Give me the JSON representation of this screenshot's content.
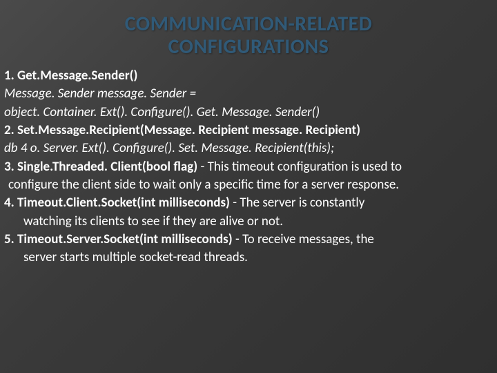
{
  "title_line1": "COMMUNICATION-RELATED",
  "title_line2": "CONFIGURATIONS",
  "items": {
    "i1": {
      "num": "1. ",
      "head": "Get.Message.Sender()",
      "code_a": "Message. Sender message. Sender =",
      "code_b": " object. Container. Ext(). Configure(). Get. Message. Sender()"
    },
    "i2": {
      "num": "2. ",
      "head": "Set.Message.Recipient(Message. Recipient message. Recipient)",
      "code": "db 4 o. Server. Ext(). Configure(). Set. Message. Recipient(this);"
    },
    "i3": {
      "num": "3. ",
      "head": "Single.Threaded. Client(bool flag)",
      "sep": " - ",
      "desc_a": "This timeout configuration is used to",
      "desc_b": " configure the client side to wait only a specific time for a server response."
    },
    "i4": {
      "num": "4. ",
      "head": "Timeout.Client.Socket(int milliseconds)",
      "sep": " - ",
      "desc_a": "The server is constantly",
      "desc_b": "watching its clients to see if they are alive or not."
    },
    "i5": {
      "num": "5. ",
      "head": "Timeout.Server.Socket(int milliseconds)",
      "sep": " - ",
      "desc_a": "To receive messages, the",
      "desc_b": "server starts multiple socket-read threads."
    }
  }
}
